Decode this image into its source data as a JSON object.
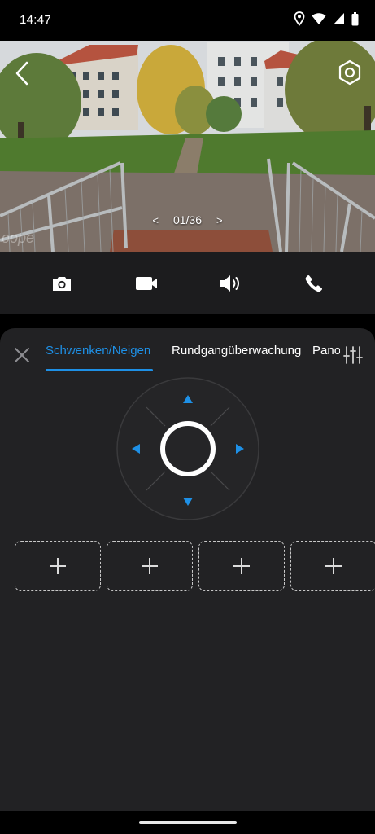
{
  "status_bar": {
    "time": "14:47",
    "icons": [
      "location-icon",
      "wifi-icon",
      "cellular-icon",
      "battery-icon"
    ]
  },
  "camera_view": {
    "pager_text": "01/36",
    "prev_glyph": "<",
    "next_glyph": ">",
    "watermark": "oope"
  },
  "actions": [
    "camera-icon",
    "video-icon",
    "speaker-icon",
    "phone-icon"
  ],
  "ptz_panel": {
    "tabs": [
      {
        "label": "Schwenken/Neigen",
        "active": true
      },
      {
        "label": "Rundgangüberwachung",
        "active": false
      },
      {
        "label": "Panorama",
        "active": false
      }
    ],
    "preset_slots": [
      "+",
      "+",
      "+",
      "+"
    ]
  },
  "colors": {
    "accent": "#1e90e6",
    "panel_bg": "#222224",
    "action_bar_bg": "#1c1c1e"
  }
}
